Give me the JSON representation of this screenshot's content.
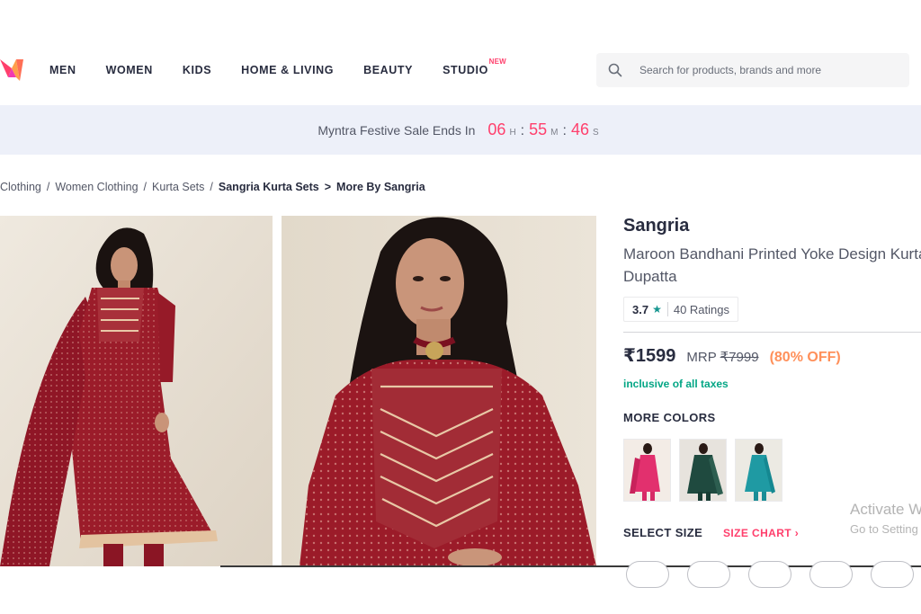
{
  "nav": {
    "items": [
      "MEN",
      "WOMEN",
      "KIDS",
      "HOME & LIVING",
      "BEAUTY",
      "STUDIO"
    ],
    "studio_badge": "NEW"
  },
  "search": {
    "placeholder": "Search for products, brands and more"
  },
  "sale_banner": {
    "text": "Myntra Festive Sale Ends In",
    "hours": "06",
    "hours_unit": "H",
    "minutes": "55",
    "minutes_unit": "M",
    "seconds": "46",
    "seconds_unit": "S"
  },
  "breadcrumb": [
    "Clothing",
    "Women Clothing",
    "Kurta Sets",
    "Sangria Kurta Sets",
    "More By Sangria"
  ],
  "product": {
    "brand": "Sangria",
    "title_line1": "Maroon Bandhani Printed Yoke Design Kurta",
    "title_line2": "Dupatta",
    "rating": "3.7",
    "rating_count": "40 Ratings",
    "price": "₹1599",
    "mrp_label": "MRP",
    "mrp": "₹7999",
    "discount": "(80% OFF)",
    "tax_note": "inclusive of all taxes",
    "more_colors_label": "MORE COLORS",
    "select_size_label": "SELECT SIZE",
    "size_chart_label": "SIZE CHART",
    "color_swatches": [
      "pink",
      "dark green",
      "teal"
    ]
  },
  "watermark": {
    "title": "Activate W",
    "subtitle": "Go to Setting"
  },
  "colors": {
    "accent": "#ff3f6c",
    "discount": "#ff905a",
    "tax": "#03a685",
    "star": "#14958f",
    "maroon": "#8c1420"
  }
}
